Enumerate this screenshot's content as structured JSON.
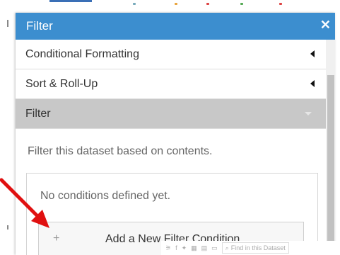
{
  "panel": {
    "title": "Filter",
    "close_icon": "close-icon",
    "header_color": "#3c8ecf"
  },
  "accordion": [
    {
      "label": "Conditional Formatting",
      "state": "collapsed"
    },
    {
      "label": "Sort & Roll-Up",
      "state": "collapsed"
    },
    {
      "label": "Filter",
      "state": "expanded"
    }
  ],
  "filter": {
    "description": "Filter this dataset based on contents.",
    "empty_text": "No conditions defined yet.",
    "add_button_label": "Add a New Filter Condition",
    "add_icon": "plus-icon"
  },
  "footer": {
    "search_placeholder": "Find in this Dataset"
  },
  "annotation": {
    "arrow_color": "#e01010"
  }
}
